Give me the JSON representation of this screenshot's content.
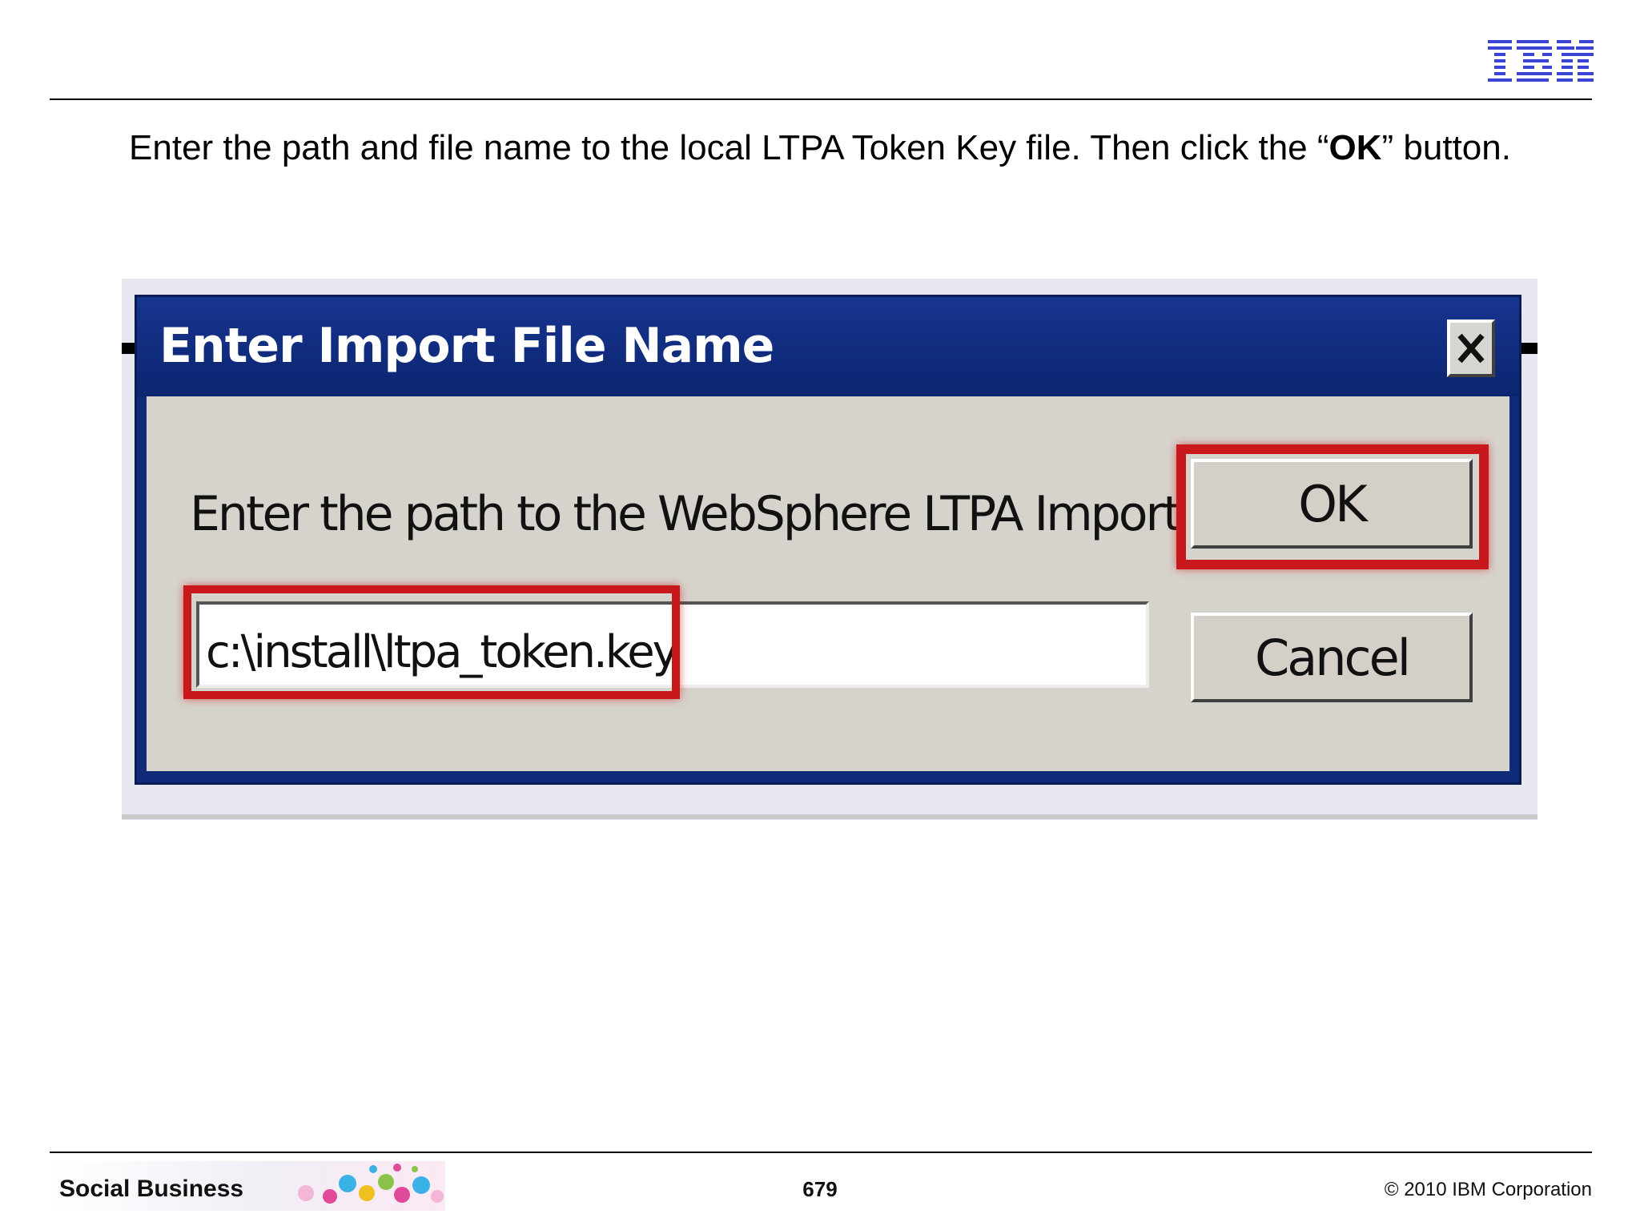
{
  "header": {
    "logo_text": "IBM",
    "logo_color": "#3a45d1"
  },
  "instruction": {
    "before": "Enter the path and file name to the local LTPA Token Key file. Then click the “",
    "bold": "OK",
    "after": "” button."
  },
  "dialog": {
    "title": "Enter Import File Name",
    "prompt": "Enter the path to the WebSphere LTPA Import file:",
    "path_value": "c:\\install\\ltpa_token.key",
    "ok_label": "OK",
    "cancel_label": "Cancel",
    "titlebar_color": "#0f2a78",
    "highlight_color": "#c8181c"
  },
  "footer": {
    "brand": "Social Business",
    "page_number": "679",
    "copyright": "© 2010 IBM Corporation"
  }
}
